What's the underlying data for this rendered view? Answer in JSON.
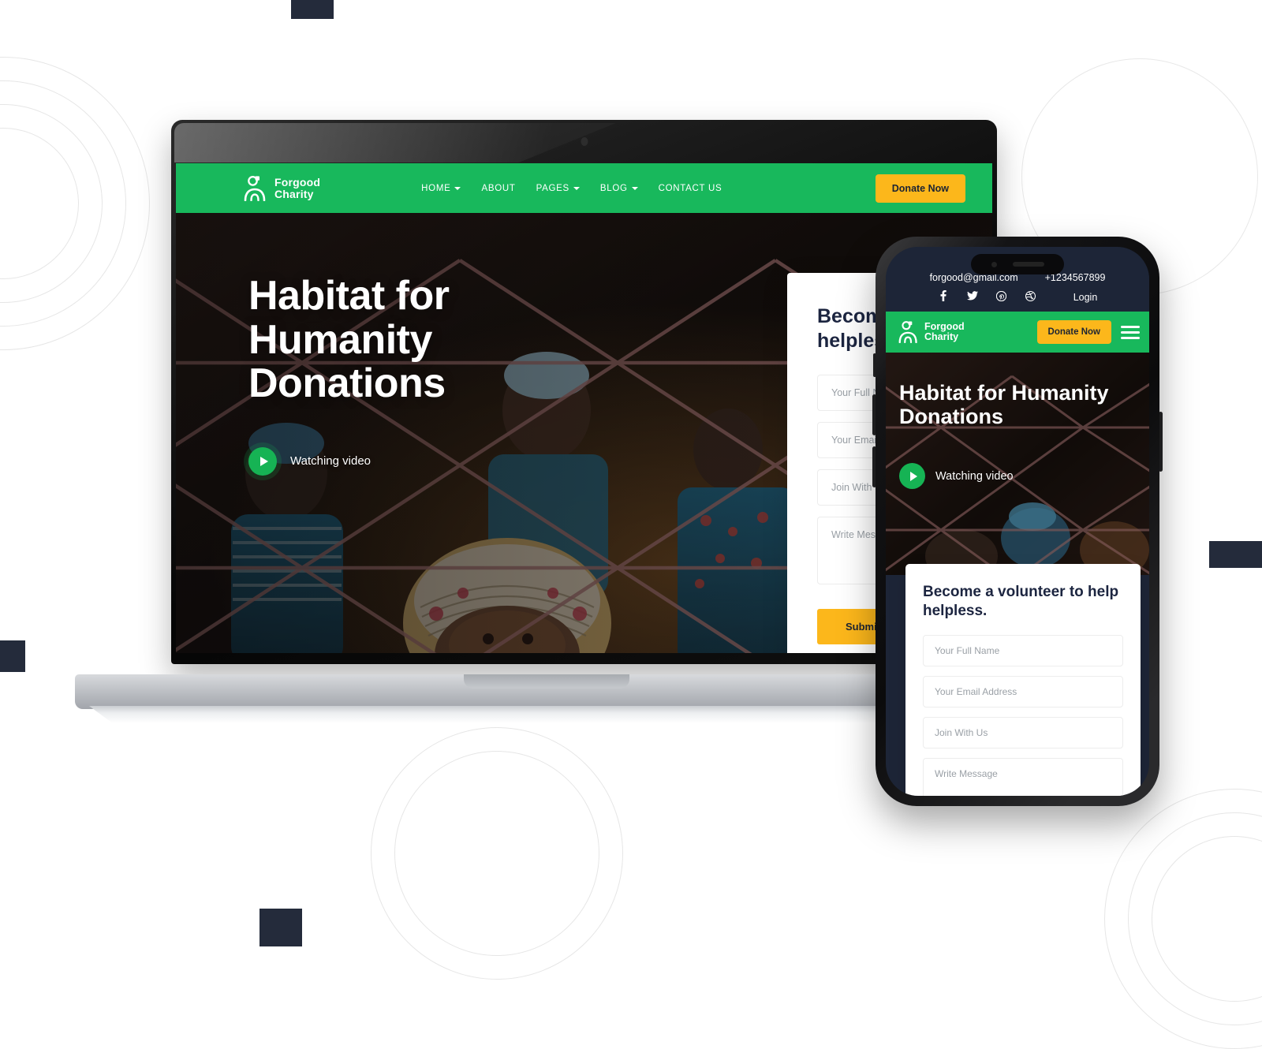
{
  "meta": {
    "scene": "Responsive website mockup on laptop and smartphone",
    "brand_green": "#18b85c",
    "accent_yellow": "#fcb71b",
    "dark_navy": "#1d2537"
  },
  "site": {
    "brand": {
      "line1": "Forgood",
      "line2": "Charity",
      "icon": "person-charity-icon"
    },
    "nav": [
      {
        "label": "HOME",
        "has_dropdown": true
      },
      {
        "label": "ABOUT",
        "has_dropdown": false
      },
      {
        "label": "PAGES",
        "has_dropdown": true
      },
      {
        "label": "BLOG",
        "has_dropdown": true
      },
      {
        "label": "CONTACT US",
        "has_dropdown": false
      }
    ],
    "donate_label": "Donate Now",
    "hero": {
      "title_line1": "Habitat for",
      "title_line2": "Humanity",
      "title_line3": "Donations",
      "watch_label": "Watching video",
      "play_icon": "play-icon"
    },
    "volunteer_form": {
      "title": "Become a volunteer to help helpless.",
      "fields": [
        {
          "name": "full-name",
          "placeholder": "Your Full Name"
        },
        {
          "name": "email",
          "placeholder": "Your Email Address"
        },
        {
          "name": "join",
          "placeholder": "Join With Us"
        },
        {
          "name": "message",
          "placeholder": "Write Message"
        }
      ],
      "submit_label": "Submit"
    }
  },
  "mobile": {
    "topbar": {
      "email": "forgood@gmail.com",
      "phone": "+1234567899",
      "login_label": "Login",
      "social": [
        {
          "name": "facebook-icon",
          "glyph": "f"
        },
        {
          "name": "twitter-icon",
          "glyph": "ᴠ"
        },
        {
          "name": "pinterest-icon",
          "glyph": "P"
        },
        {
          "name": "dribbble-icon",
          "glyph": "●"
        }
      ]
    },
    "brand": {
      "line1": "Forgood",
      "line2": "Charity"
    },
    "donate_label": "Donate Now",
    "menu_icon": "hamburger-menu-icon",
    "hero": {
      "title_line1": "Habitat for Humanity",
      "title_line2": "Donations",
      "watch_label": "Watching video"
    },
    "form": {
      "title": "Become a volunteer to help helpless.",
      "fields": [
        {
          "name": "full-name",
          "placeholder": "Your Full Name"
        },
        {
          "name": "email",
          "placeholder": "Your Email Address"
        },
        {
          "name": "join",
          "placeholder": "Join With Us"
        },
        {
          "name": "message",
          "placeholder": "Write Message"
        }
      ]
    }
  }
}
